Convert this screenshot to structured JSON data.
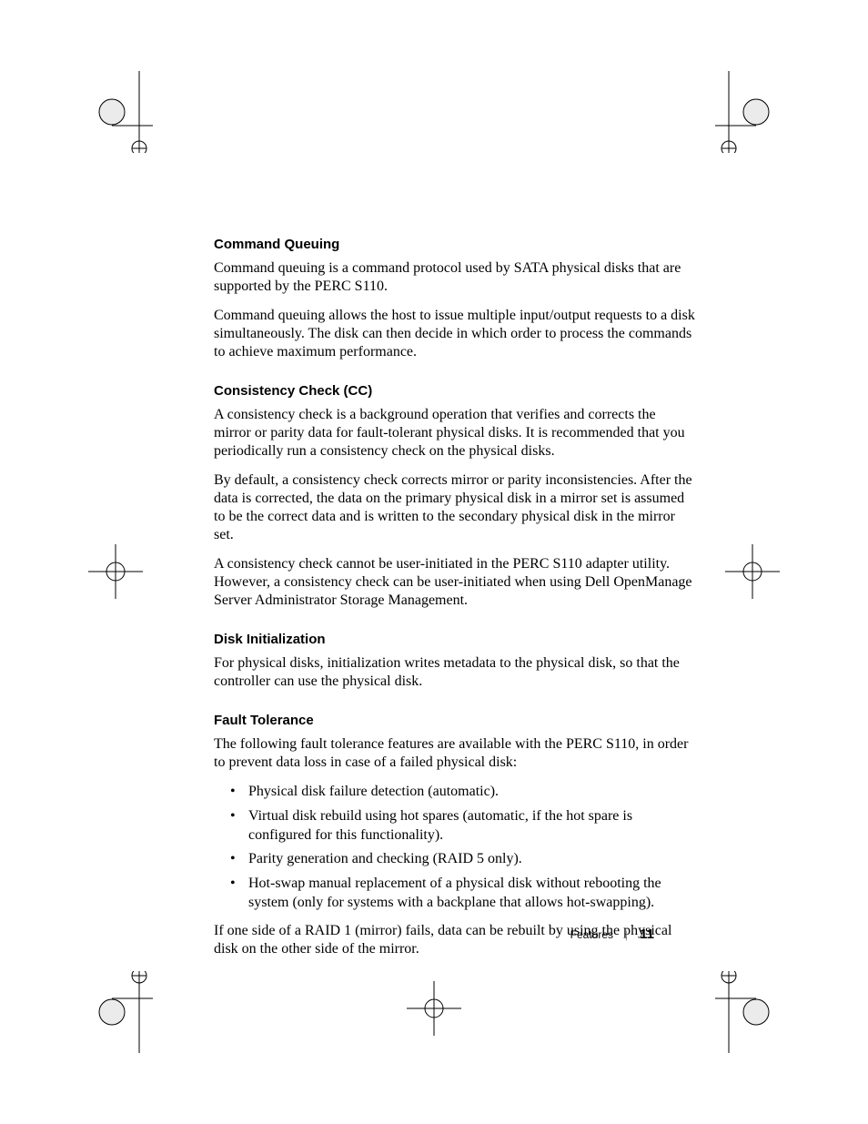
{
  "sections": [
    {
      "heading": "Command Queuing",
      "paragraphs": [
        "Command queuing is a command protocol used by SATA physical disks that are supported by the PERC S110.",
        "Command queuing allows the host to issue multiple input/output requests to a disk simultaneously. The disk can then decide in which order to process the commands to achieve maximum performance."
      ],
      "bullets": []
    },
    {
      "heading": "Consistency Check (CC)",
      "paragraphs": [
        "A consistency check is a background operation that verifies and corrects the mirror or parity data for fault-tolerant physical disks. It is recommended that you periodically run a consistency check on the physical disks.",
        "By default, a consistency check corrects mirror or parity inconsistencies. After the data is corrected, the data on the primary physical disk in a mirror set is assumed to be the correct data and is written to the secondary physical disk in the mirror set.",
        "A consistency check cannot be user-initiated in the PERC S110 adapter utility. However, a consistency check can be user-initiated when using Dell OpenManage Server Administrator Storage Management."
      ],
      "bullets": []
    },
    {
      "heading": "Disk Initialization",
      "paragraphs": [
        "For physical disks, initialization writes metadata to the physical disk, so that the controller can use the physical disk."
      ],
      "bullets": []
    },
    {
      "heading": "Fault Tolerance",
      "paragraphs": [
        "The following fault tolerance features are available with the PERC S110, in order to prevent data loss in case of a failed physical disk:"
      ],
      "bullets": [
        "Physical disk failure detection (automatic).",
        "Virtual disk rebuild using hot spares (automatic, if the hot spare is configured for this functionality).",
        "Parity generation and checking (RAID 5 only).",
        "Hot-swap manual replacement of a physical disk without rebooting the system (only for systems with a backplane that allows hot-swapping)."
      ],
      "trailing": [
        "If one side of a RAID 1 (mirror) fails, data can be rebuilt by using the physical disk on the other side of the mirror."
      ]
    }
  ],
  "footer": {
    "label": "Features",
    "separator": "|",
    "page": "11"
  }
}
